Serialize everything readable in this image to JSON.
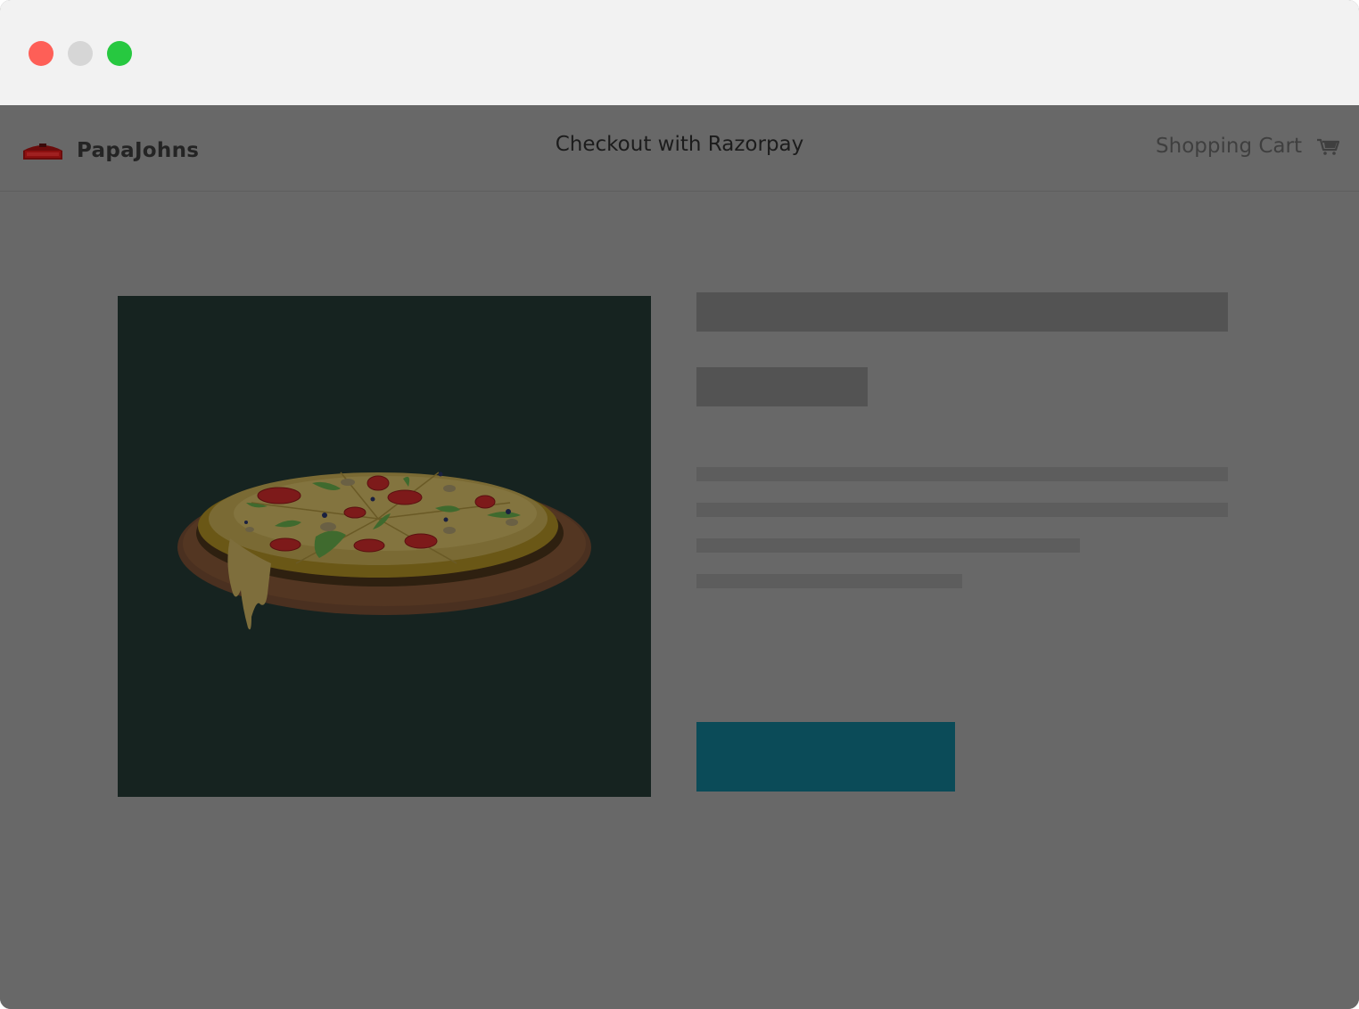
{
  "window": {
    "controls": [
      "close",
      "minimize",
      "maximize"
    ]
  },
  "navbar": {
    "brand_name": "PapaJohns",
    "brand_logo": "papajohns-logo",
    "title": "Checkout with Razorpay",
    "cart_label": "Shopping Cart",
    "cart_icon": "shopping-cart-icon"
  },
  "product": {
    "image": "pizza-illustration"
  },
  "colors": {
    "overlay_background": "#686868",
    "image_background": "#162320",
    "button": "#0b4b58",
    "titlebar": "#f2f2f2"
  }
}
